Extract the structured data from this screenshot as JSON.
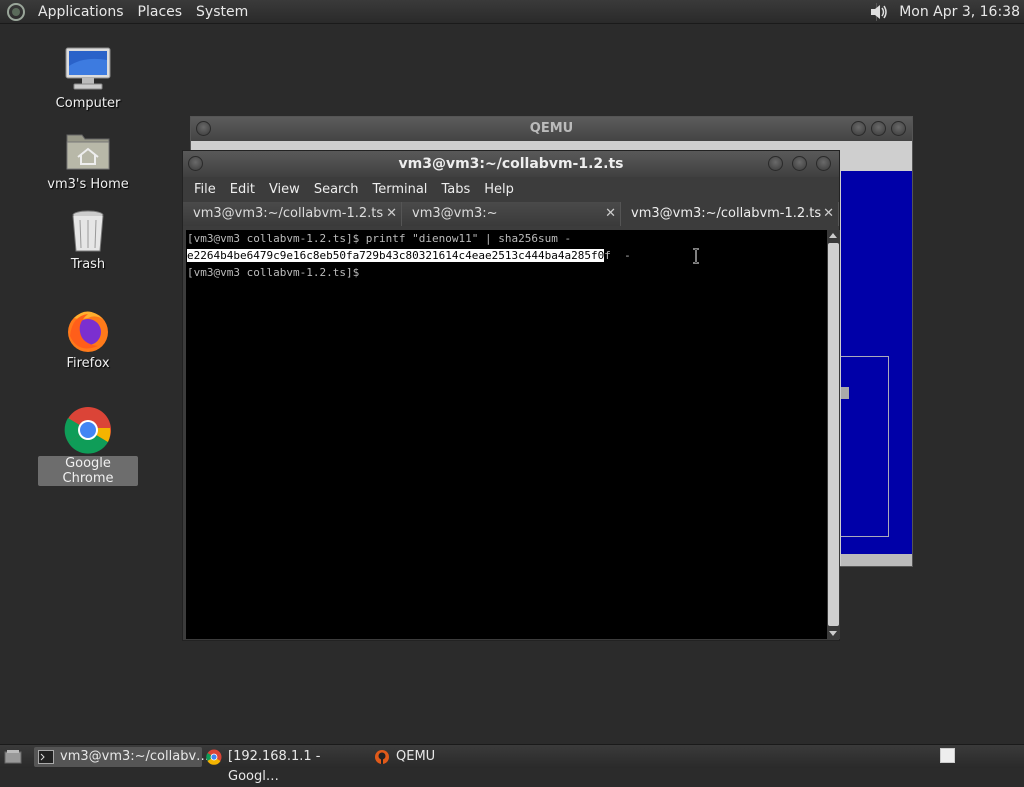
{
  "top_panel": {
    "menus": [
      "Applications",
      "Places",
      "System"
    ],
    "clock": "Mon Apr  3, 16:38"
  },
  "desktop_icons": [
    {
      "label": "Computer",
      "icon": "computer-icon"
    },
    {
      "label": "vm3's Home",
      "icon": "home-folder-icon"
    },
    {
      "label": "Trash",
      "icon": "trash-icon"
    },
    {
      "label": "Firefox",
      "icon": "firefox-icon"
    },
    {
      "label": "Google Chrome",
      "icon": "chrome-icon",
      "selected": true
    }
  ],
  "qemu_window": {
    "title": "QEMU"
  },
  "terminal_window": {
    "title": "vm3@vm3:~/collabvm-1.2.ts",
    "menus": [
      "File",
      "Edit",
      "View",
      "Search",
      "Terminal",
      "Tabs",
      "Help"
    ],
    "tabs": [
      {
        "label": "vm3@vm3:~/collabvm-1.2.ts",
        "active": false
      },
      {
        "label": "vm3@vm3:~",
        "active": false
      },
      {
        "label": "vm3@vm3:~/collabvm-1.2.ts",
        "active": true
      }
    ],
    "lines": {
      "line1": "[vm3@vm3 collabvm-1.2.ts]$ printf \"dienow11\" | sha256sum -",
      "line2_selected": "e2264b4be6479c9e16c8eb50fa729b43c80321614c4eae2513c444ba4a285f0",
      "line2_rest": "f  -",
      "line3": "[vm3@vm3 collabvm-1.2.ts]$ "
    }
  },
  "taskbar": {
    "tasks": [
      {
        "label": "vm3@vm3:~/collabv…",
        "icon": "terminal-icon",
        "active": true
      },
      {
        "label": "[192.168.1.1 - Googl…",
        "icon": "chrome-icon",
        "active": false
      },
      {
        "label": "QEMU",
        "icon": "qemu-icon",
        "active": false
      }
    ]
  }
}
